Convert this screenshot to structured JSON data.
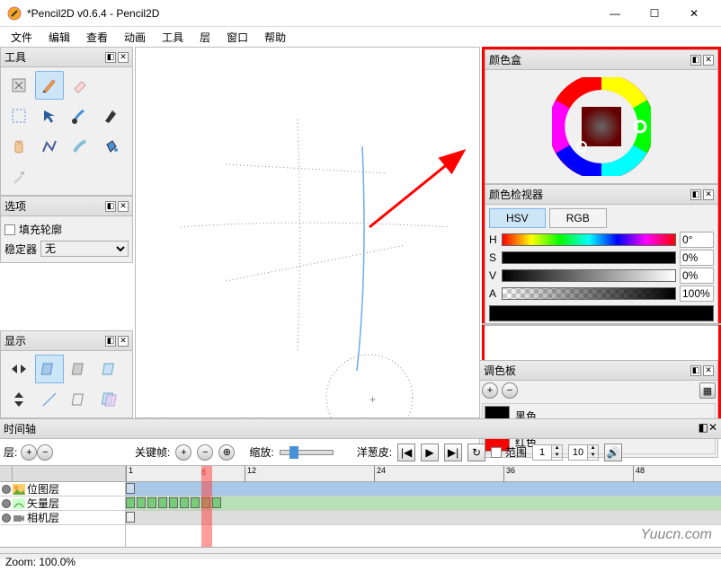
{
  "window": {
    "title": "*Pencil2D v0.6.4 - Pencil2D",
    "buttons": {
      "min": "—",
      "max": "☐",
      "close": "✕"
    }
  },
  "menubar": [
    "文件",
    "编辑",
    "查看",
    "动画",
    "工具",
    "层",
    "窗口",
    "帮助"
  ],
  "panels": {
    "tools": {
      "title": "工具"
    },
    "options": {
      "title": "选项",
      "fill_contour": "填充轮廓",
      "stabilizer_label": "稳定器",
      "stabilizer_value": "无"
    },
    "display": {
      "title": "显示"
    },
    "colorbox": {
      "title": "颜色盒"
    },
    "inspector": {
      "title": "颜色检视器",
      "tabs": {
        "hsv": "HSV",
        "rgb": "RGB"
      },
      "h": {
        "label": "H",
        "value": "0°"
      },
      "s": {
        "label": "S",
        "value": "0%"
      },
      "v": {
        "label": "V",
        "value": "0%"
      },
      "a": {
        "label": "A",
        "value": "100%"
      }
    },
    "palette": {
      "title": "调色板",
      "items": [
        {
          "name": "黑色",
          "color": "#000000"
        },
        {
          "name": "红色",
          "color": "#ff0000"
        }
      ]
    },
    "timeline": {
      "title": "时间轴",
      "layer_label": "层:",
      "keyframe_label": "关键帧:",
      "zoom_label": "缩放:",
      "onion_label": "洋葱皮:",
      "range_label": "范围",
      "range_start": "1",
      "range_end": "10",
      "current_frame": "8",
      "ruler_marks": [
        "1",
        "12",
        "24",
        "36",
        "48"
      ],
      "layers": [
        "位图层",
        "矢量层",
        "相机层"
      ]
    }
  },
  "status": {
    "zoom": "Zoom: 100.0%"
  },
  "watermark": "Yuucn.com",
  "icons": {
    "select": "select-icon",
    "move": "move-icon",
    "hand": "hand-icon",
    "pencil": "pencil-icon",
    "pen": "pen-icon",
    "brush": "brush-icon",
    "eraser": "eraser-icon",
    "bucket": "bucket-icon",
    "eyedropper": "eyedropper-icon",
    "polyline": "polyline-icon",
    "smudge": "smudge-icon",
    "clear": "clear-icon"
  }
}
